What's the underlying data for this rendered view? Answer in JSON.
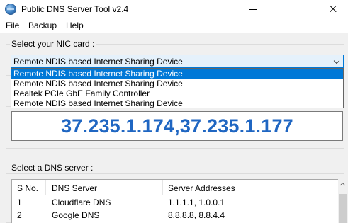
{
  "window": {
    "title": "Public DNS Server Tool v2.4"
  },
  "menu": {
    "file": "File",
    "backup": "Backup",
    "help": "Help"
  },
  "nic": {
    "label": "Select your NIC card :",
    "selected": "Remote NDIS based Internet Sharing Device",
    "options": [
      "Remote NDIS based Internet Sharing Device",
      "Remote NDIS based Internet Sharing Device",
      "Realtek PCIe GbE Family Controller",
      "Remote NDIS based Internet Sharing Device"
    ]
  },
  "current_dns": "37.235.1.174,37.235.1.177",
  "dns_list": {
    "label": "Select a DNS server :",
    "headers": [
      "S No.",
      "DNS Server",
      "Server Addresses"
    ],
    "rows": [
      {
        "no": "1",
        "server": "Cloudflare DNS",
        "addresses": "1.1.1.1, 1.0.0.1"
      },
      {
        "no": "2",
        "server": "Google DNS",
        "addresses": "8.8.8.8, 8.8.4.4"
      }
    ]
  }
}
